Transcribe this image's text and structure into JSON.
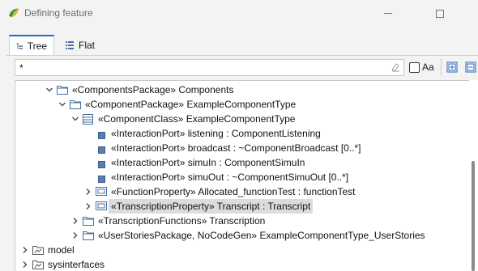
{
  "window": {
    "title": "Defining feature"
  },
  "tabs": [
    {
      "label": "Tree"
    },
    {
      "label": "Flat"
    }
  ],
  "filter": {
    "value": "*",
    "case_label": "Aa"
  },
  "tree": [
    {
      "label": "«ComponentsPackage» Components",
      "depth": 0,
      "twisty": "expanded",
      "icon": "folder-icon"
    },
    {
      "label": "«ComponentPackage» ExampleComponentType",
      "depth": 1,
      "twisty": "expanded",
      "icon": "folder-icon"
    },
    {
      "label": "«ComponentClass» ExampleComponentType",
      "depth": 2,
      "twisty": "expanded",
      "icon": "class-icon"
    },
    {
      "label": "«InteractionPort» listening : ComponentListening",
      "depth": 3,
      "twisty": "none",
      "icon": "port-icon"
    },
    {
      "label": "«InteractionPort» broadcast : ~ComponentBroadcast [0..*]",
      "depth": 3,
      "twisty": "none",
      "icon": "port-icon"
    },
    {
      "label": "«InteractionPort» simuIn : ComponentSimuIn",
      "depth": 3,
      "twisty": "none",
      "icon": "port-icon"
    },
    {
      "label": "«InteractionPort» simuOut : ~ComponentSimuOut [0..*]",
      "depth": 3,
      "twisty": "none",
      "icon": "port-icon"
    },
    {
      "label": "«FunctionProperty» Allocated_functionTest  : functionTest",
      "depth": 3,
      "twisty": "collapsed",
      "icon": "property-icon"
    },
    {
      "label": "«TranscriptionProperty» Transcript : Transcript",
      "depth": 3,
      "twisty": "collapsed",
      "icon": "property-icon",
      "selected": true
    },
    {
      "label": "«TranscriptionFunctions» Transcription",
      "depth": 2,
      "twisty": "collapsed",
      "icon": "folder-icon"
    },
    {
      "label": "«UserStoriesPackage, NoCodeGen» ExampleComponentType_UserStories",
      "depth": 2,
      "twisty": "collapsed",
      "icon": "folder-icon"
    },
    {
      "label": "model",
      "depth": -1,
      "twisty": "collapsed",
      "icon": "model-folder-icon"
    },
    {
      "label": "sysinterfaces",
      "depth": -1,
      "twisty": "collapsed",
      "icon": "model-folder-icon"
    }
  ]
}
